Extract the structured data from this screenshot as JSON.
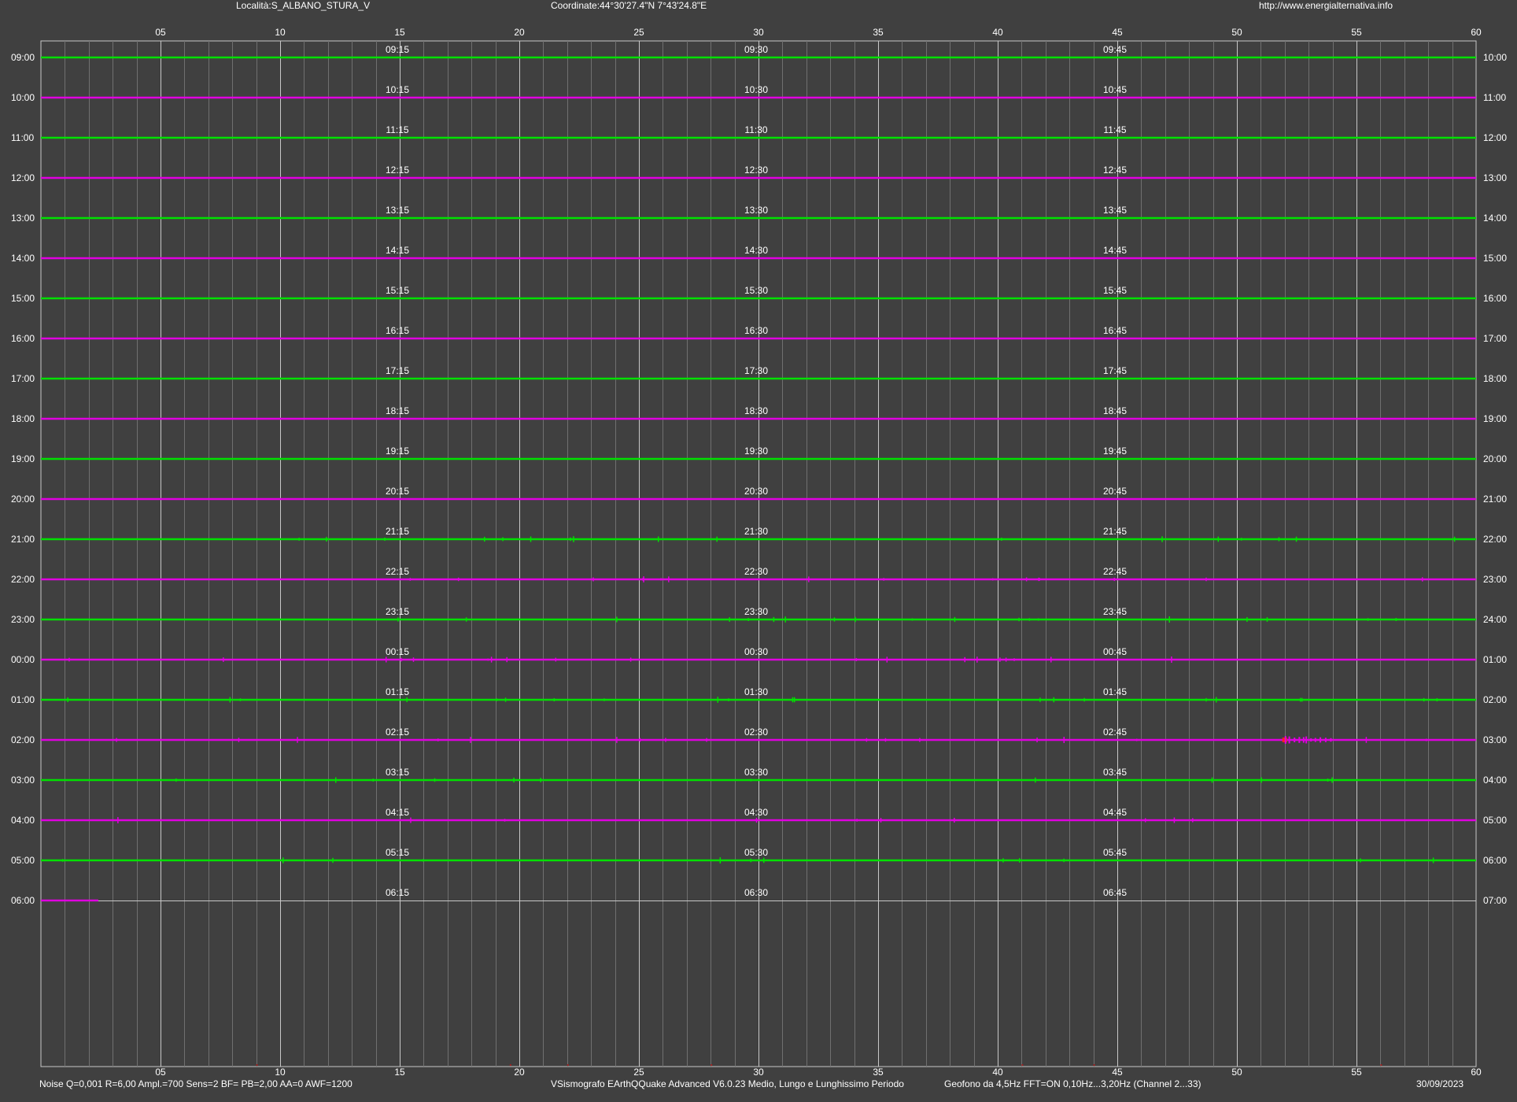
{
  "header": {
    "location": "Località:S_ALBANO_STURA_V",
    "coordinates": "Coordinate:44°30'27.4\"N 7°43'24.8\"E",
    "url": "http://www.energialternativa.info"
  },
  "footer": {
    "params": "Noise Q=0,001 R=6,00 Ampl.=700 Sens=2 BF= PB=2,00 AA=0 AWF=1200",
    "software": "VSismografo  EArthQQuake Advanced V6.0.23  Medio, Lungo e Lunghissimo Periodo",
    "sensor": "Geofono da 4,5Hz FFT=ON 0,10Hz...3,20Hz     (Channel 2...33)",
    "date": "30/09/2023"
  },
  "colors": {
    "background": "#404040",
    "grid_major": "#c8c8c8",
    "grid_minor": "#707070",
    "trace_even": "#00e000",
    "trace_odd": "#e000e0",
    "event": "#ff2020",
    "text": "#ffffff"
  },
  "chart_data": {
    "type": "line",
    "xlabel_top_ticks": [
      "05",
      "10",
      "15",
      "20",
      "25",
      "30",
      "35",
      "40",
      "45",
      "50",
      "55",
      "60"
    ],
    "xlabel_bottom_ticks": [
      "05",
      "10",
      "15",
      "20",
      "25",
      "30",
      "35",
      "40",
      "45",
      "50",
      "55",
      "60"
    ],
    "xlim": [
      0,
      60
    ],
    "x_unit": "minutes",
    "rows": [
      {
        "left": "09:00",
        "right": "10:00",
        "q": [
          "09:15",
          "09:30",
          "09:45"
        ],
        "color": "even",
        "activity": 0
      },
      {
        "left": "10:00",
        "right": "11:00",
        "q": [
          "10:15",
          "10:30",
          "10:45"
        ],
        "color": "odd",
        "activity": 0
      },
      {
        "left": "11:00",
        "right": "12:00",
        "q": [
          "11:15",
          "11:30",
          "11:45"
        ],
        "color": "even",
        "activity": 0
      },
      {
        "left": "12:00",
        "right": "13:00",
        "q": [
          "12:15",
          "12:30",
          "12:45"
        ],
        "color": "odd",
        "activity": 0
      },
      {
        "left": "13:00",
        "right": "14:00",
        "q": [
          "13:15",
          "13:30",
          "13:45"
        ],
        "color": "even",
        "activity": 0
      },
      {
        "left": "14:00",
        "right": "15:00",
        "q": [
          "14:15",
          "14:30",
          "14:45"
        ],
        "color": "odd",
        "activity": 0
      },
      {
        "left": "15:00",
        "right": "16:00",
        "q": [
          "15:15",
          "15:30",
          "15:45"
        ],
        "color": "even",
        "activity": 0
      },
      {
        "left": "16:00",
        "right": "17:00",
        "q": [
          "16:15",
          "16:30",
          "16:45"
        ],
        "color": "odd",
        "activity": 0
      },
      {
        "left": "17:00",
        "right": "18:00",
        "q": [
          "17:15",
          "17:30",
          "17:45"
        ],
        "color": "even",
        "activity": 0
      },
      {
        "left": "18:00",
        "right": "19:00",
        "q": [
          "18:15",
          "18:30",
          "18:45"
        ],
        "color": "odd",
        "activity": 0
      },
      {
        "left": "19:00",
        "right": "20:00",
        "q": [
          "19:15",
          "19:30",
          "19:45"
        ],
        "color": "even",
        "activity": 0
      },
      {
        "left": "20:00",
        "right": "21:00",
        "q": [
          "20:15",
          "20:30",
          "20:45"
        ],
        "color": "odd",
        "activity": 0
      },
      {
        "left": "21:00",
        "right": "22:00",
        "q": [
          "21:15",
          "21:30",
          "21:45"
        ],
        "color": "even",
        "activity": 1
      },
      {
        "left": "22:00",
        "right": "23:00",
        "q": [
          "22:15",
          "22:30",
          "22:45"
        ],
        "color": "odd",
        "activity": 1
      },
      {
        "left": "23:00",
        "right": "24:00",
        "q": [
          "23:15",
          "23:30",
          "23:45"
        ],
        "color": "even",
        "activity": 1
      },
      {
        "left": "00:00",
        "right": "01:00",
        "q": [
          "00:15",
          "00:30",
          "00:45"
        ],
        "color": "odd",
        "activity": 1
      },
      {
        "left": "01:00",
        "right": "02:00",
        "q": [
          "01:15",
          "01:30",
          "01:45"
        ],
        "color": "even",
        "activity": 1
      },
      {
        "left": "02:00",
        "right": "03:00",
        "q": [
          "02:15",
          "02:30",
          "02:45"
        ],
        "color": "odd",
        "activity": 1,
        "event": {
          "start_min": 51.9,
          "end_min": 54.0
        }
      },
      {
        "left": "03:00",
        "right": "04:00",
        "q": [
          "03:15",
          "03:30",
          "03:45"
        ],
        "color": "even",
        "activity": 1
      },
      {
        "left": "04:00",
        "right": "05:00",
        "q": [
          "04:15",
          "04:30",
          "04:45"
        ],
        "color": "odd",
        "activity": 1
      },
      {
        "left": "05:00",
        "right": "06:00",
        "q": [
          "05:15",
          "05:30",
          "05:45"
        ],
        "color": "even",
        "activity": 1
      },
      {
        "left": "06:00",
        "right": "07:00",
        "q": [
          "06:15",
          "06:30",
          "06:45"
        ],
        "color": "odd",
        "activity": 0,
        "partial_until_min": 2.4
      }
    ]
  }
}
